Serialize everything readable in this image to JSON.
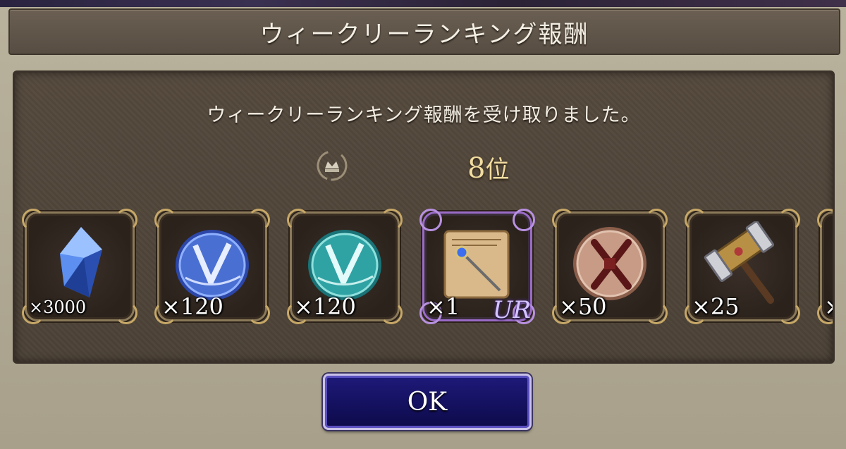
{
  "dialog": {
    "title": "ウィークリーランキング報酬",
    "message": "ウィークリーランキング報酬を受け取りました。",
    "rank": "8",
    "rank_suffix": "位",
    "ok_label": "OK"
  },
  "rewards": [
    {
      "icon": "blue-crystal-icon",
      "quantity": "×3000",
      "rarity": ""
    },
    {
      "icon": "blue-veritas-medal-icon",
      "quantity": "×120",
      "rarity": ""
    },
    {
      "icon": "teal-veritas-medal-icon",
      "quantity": "×120",
      "rarity": ""
    },
    {
      "icon": "staff-scroll-icon",
      "quantity": "×1",
      "rarity": "UR"
    },
    {
      "icon": "bronze-sword-medal-icon",
      "quantity": "×50",
      "rarity": ""
    },
    {
      "icon": "hammer-icon",
      "quantity": "×25",
      "rarity": ""
    },
    {
      "icon": "partial-item-icon",
      "quantity": "×",
      "rarity": ""
    }
  ],
  "colors": {
    "rank_gold": "#f1dca0",
    "ok_button": "#1e1a7a",
    "panel": "#4c4237"
  }
}
